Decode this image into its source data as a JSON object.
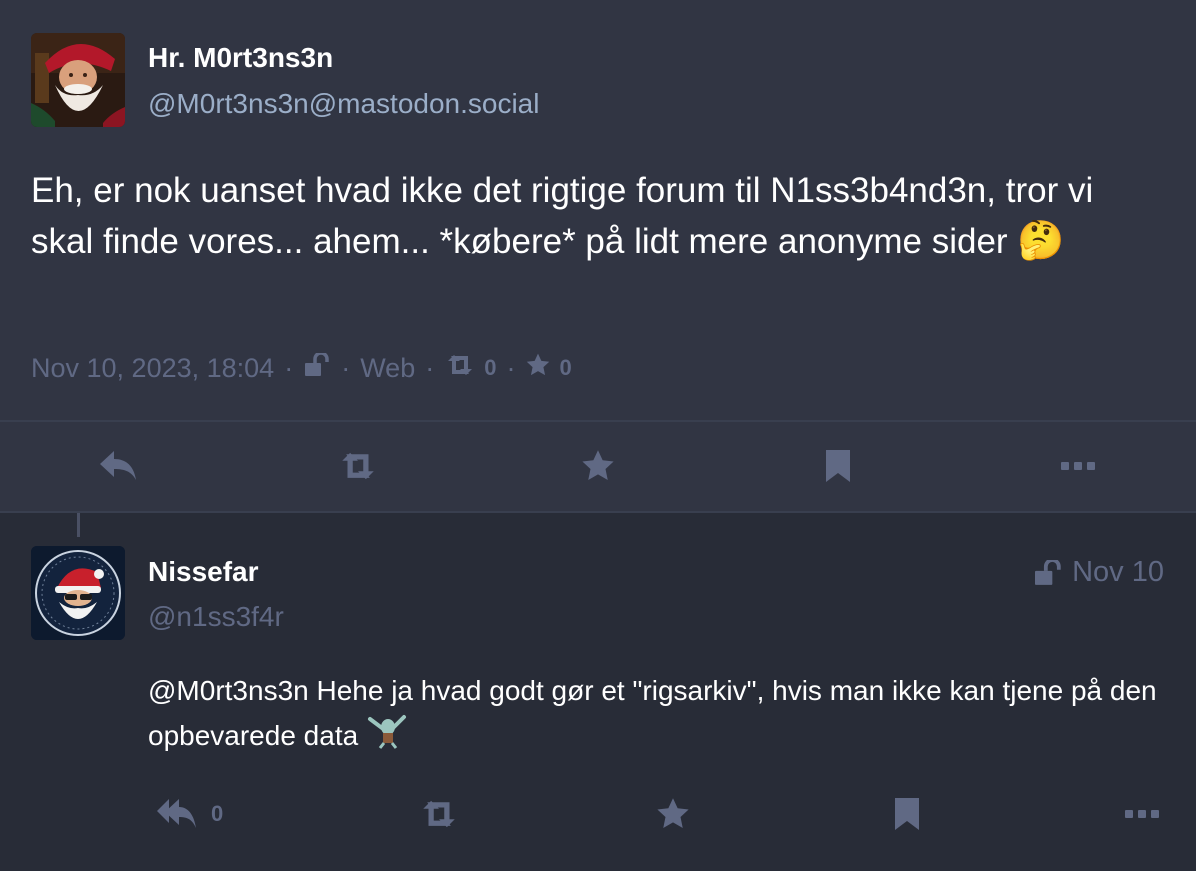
{
  "main_post": {
    "display_name": "Hr. M0rt3ns3n",
    "handle": "@M0rt3ns3n@mastodon.social",
    "content": "Eh, er nok uanset hvad ikke det rigtige forum til N1ss3b4nd3n, tror vi skal finde vores... ahem... *købere* på lidt mere anonyme sider",
    "emoji": "🤔",
    "timestamp": "Nov 10, 2023, 18:04",
    "visibility_icon": "unlock-icon",
    "application": "Web",
    "boosts": "0",
    "favourites": "0",
    "sep": "·"
  },
  "reply_post": {
    "display_name": "Nissefar",
    "handle": "@n1ss3f4r",
    "date": "Nov 10",
    "mention": "@M0rt3ns3n",
    "content": " Hehe ja hvad godt gør et \"rigsarkiv\", hvis man ikke kan tjene på den opbevarede data",
    "custom_emoji": "squidward-dab",
    "reply_count": "0"
  },
  "colors": {
    "background": "#282c37",
    "detailed_background": "#313543",
    "text": "#ffffff",
    "secondary": "#9baec8",
    "muted": "#606984"
  }
}
